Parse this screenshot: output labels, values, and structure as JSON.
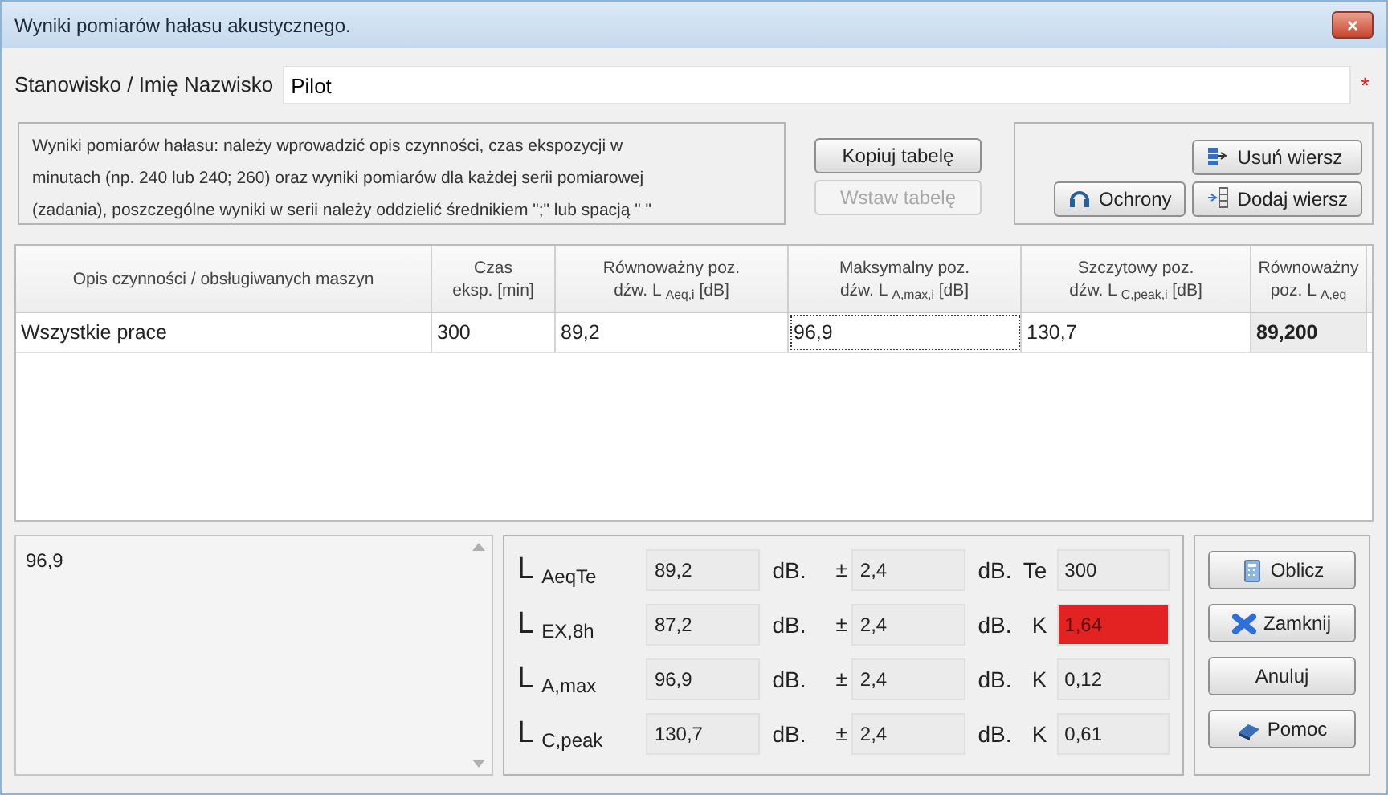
{
  "window": {
    "title": "Wyniki pomiarów hałasu akustycznego.",
    "close": "×"
  },
  "name_row": {
    "label": "Stanowisko / Imię Nazwisko",
    "value": "Pilot",
    "required_mark": "*"
  },
  "info": "Wyniki pomiarów hałasu: należy wprowadzić opis czynności, czas ekspozycji w minutach (np. 240 lub 240; 260) oraz wyniki pomiarów dla każdej serii pomiarowej (zadania), poszczególne wyniki w serii należy oddzielić średnikiem \";\" lub spacją \" \"",
  "table_buttons": [
    {
      "label": "Kopiuj tabelę",
      "disabled": false
    },
    {
      "label": "Wstaw tabelę",
      "disabled": true
    }
  ],
  "row_buttons": [
    {
      "label": "Ochrony",
      "kind": "headphones",
      "disabled": false
    },
    {
      "label": "Usuń wiersz",
      "kind": "remove",
      "disabled": false
    },
    {
      "label": "Dodaj wiersz",
      "kind": "add",
      "disabled": false
    }
  ],
  "table": {
    "columns": [
      {
        "lines": [
          "Opis czynności / obsługiwanych maszyn"
        ]
      },
      {
        "lines": [
          "Czas",
          "eksp.  [min]"
        ]
      },
      {
        "lines": [
          "Równoważny poz.",
          "dźw. L $_{Aeq,i}$    [dB]"
        ]
      },
      {
        "lines": [
          "Maksymalny poz.",
          "dźw. L $_{A,max,i}$  [dB]"
        ]
      },
      {
        "lines": [
          "Szczytowy poz.",
          "dźw. L $_{C,peak,i}$ [dB]"
        ]
      },
      {
        "lines": [
          "Równoważny",
          "poz. L $_{A,eq}$"
        ]
      }
    ],
    "rows": [
      [
        {
          "text": "Wszystkie prace",
          "kind": "input",
          "focused": false
        },
        {
          "text": "300",
          "kind": "input",
          "focused": false
        },
        {
          "text": "89,2",
          "kind": "input",
          "focused": false
        },
        {
          "text": "96,9",
          "kind": "input",
          "focused": true
        },
        {
          "text": "130,7",
          "kind": "input",
          "focused": false
        },
        {
          "text": "89,200",
          "kind": "computed",
          "focused": false
        }
      ]
    ]
  },
  "notes": "96,9",
  "results": [
    {
      "symbol": "L",
      "subscript": "AeqTe",
      "value": "89,2",
      "unit": "dB.",
      "pm": "±",
      "uncertainty": "2,4",
      "unit2": "dB.",
      "param": "Te",
      "param_value": "300",
      "alarm": false
    },
    {
      "symbol": "L",
      "subscript": "EX,8h",
      "value": "87,2",
      "unit": "dB.",
      "pm": "±",
      "uncertainty": "2,4",
      "unit2": "dB.",
      "param": "K",
      "param_value": "1,64",
      "alarm": true
    },
    {
      "symbol": "L",
      "subscript": "A,max",
      "value": "96,9",
      "unit": "dB.",
      "pm": "±",
      "uncertainty": "2,4",
      "unit2": "dB.",
      "param": "K",
      "param_value": "0,12",
      "alarm": false
    },
    {
      "symbol": "L",
      "subscript": "C,peak",
      "value": "130,7",
      "unit": "dB.",
      "pm": "±",
      "uncertainty": "2,4",
      "unit2": "dB.",
      "param": "K",
      "param_value": "0,61",
      "alarm": false
    }
  ],
  "action_buttons": [
    {
      "label": "Oblicz",
      "kind": "calculator"
    },
    {
      "label": "Zamknij",
      "kind": "cross"
    },
    {
      "label": "Anuluj",
      "kind": "plain"
    },
    {
      "label": "Pomoc",
      "kind": "book"
    }
  ]
}
